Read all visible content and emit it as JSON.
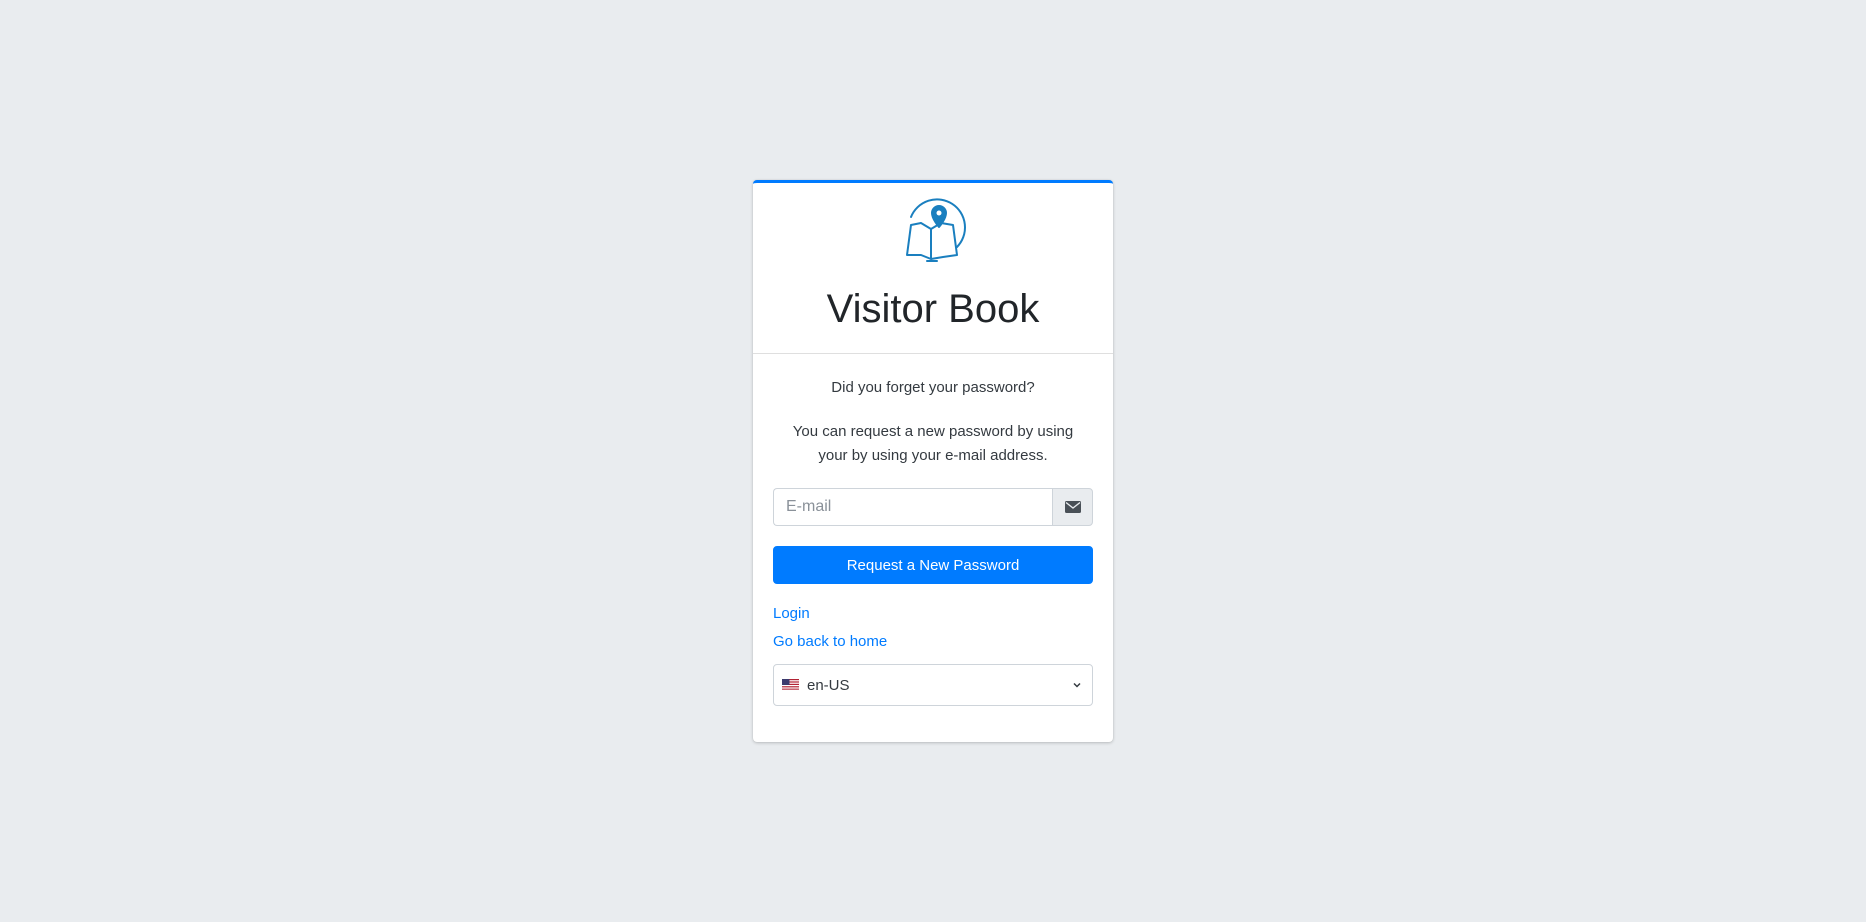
{
  "brand": {
    "title": "Visitor Book",
    "logo_icon": "map-pin-icon",
    "accent_color": "#007bff",
    "logo_color": "#1a7fbf"
  },
  "form": {
    "message_1": "Did you forget your password?",
    "message_2": "You can request a new password by using your by using your e-mail address.",
    "email_placeholder": "E-mail",
    "email_value": "",
    "email_icon": "envelope-icon",
    "submit_label": "Request a New Password"
  },
  "links": {
    "login": "Login",
    "home": "Go back to home"
  },
  "language": {
    "selected": "en-US",
    "flag_icon": "us-flag-icon"
  }
}
